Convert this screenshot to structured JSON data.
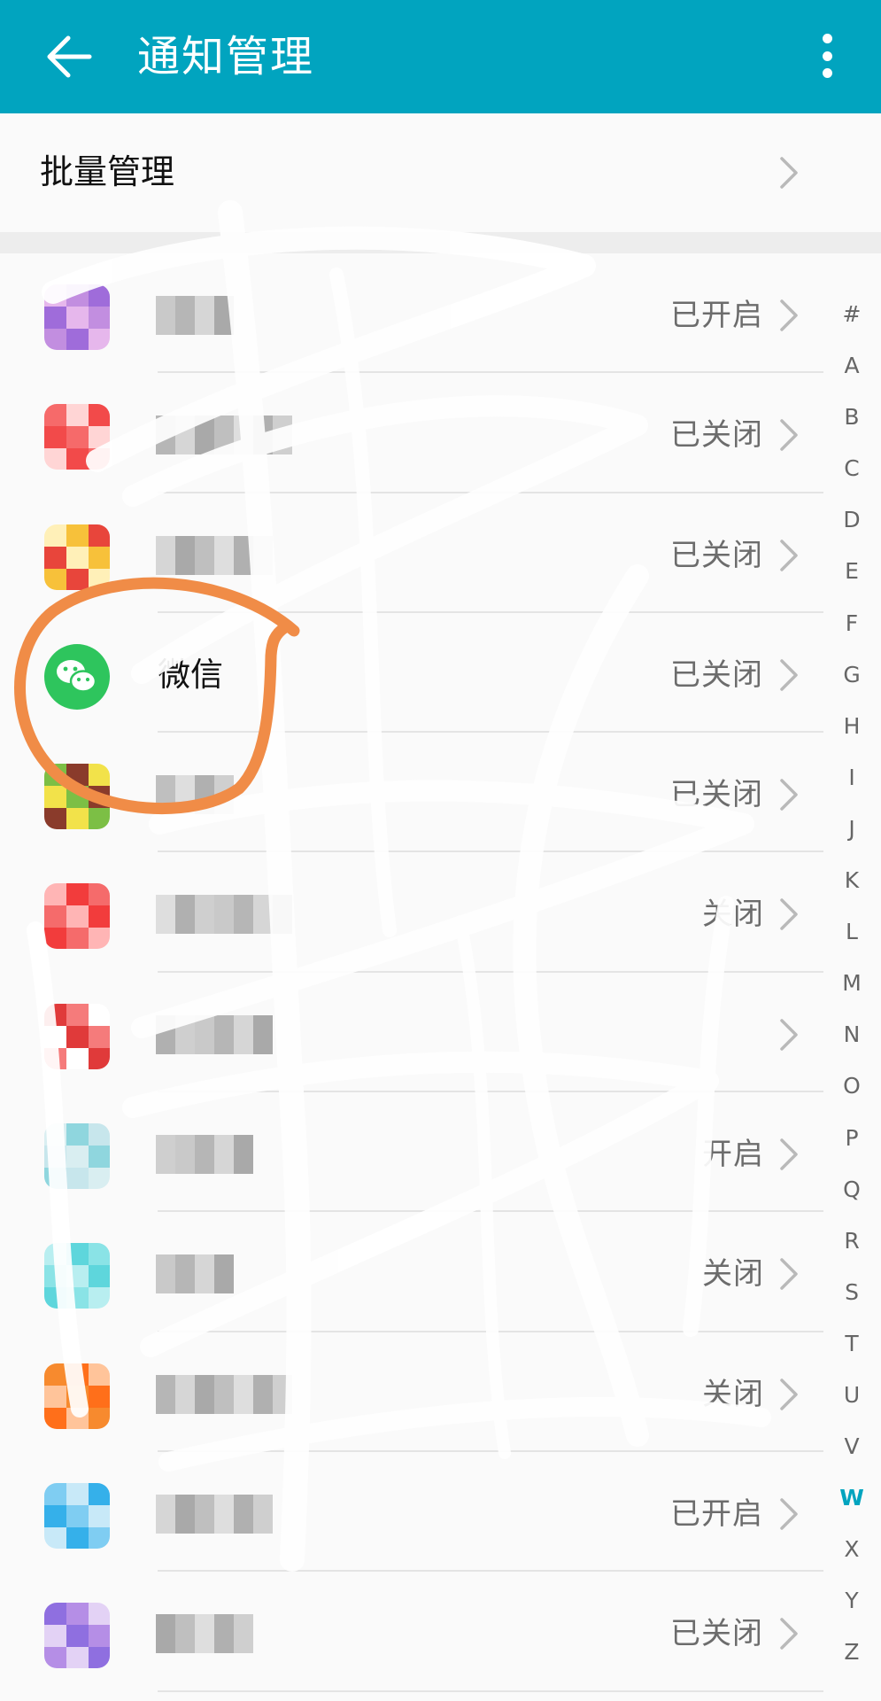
{
  "header": {
    "title": "通知管理",
    "back_icon": "arrow-left-icon",
    "more_icon": "more-vertical-icon",
    "bar_color": "#01a4bf"
  },
  "batch": {
    "label": "批量管理"
  },
  "apps": [
    {
      "name": "",
      "status": "已开启",
      "icon_colors": [
        "#e6b7ec",
        "#c28ee0",
        "#9f6cda"
      ]
    },
    {
      "name": "",
      "status": "已关闭",
      "icon_colors": [
        "#f24a4a",
        "#f66a6a",
        "#ffd5d5"
      ]
    },
    {
      "name": "",
      "status": "已关闭",
      "icon_colors": [
        "#f7c13a",
        "#e8453b",
        "#fff0b8"
      ]
    },
    {
      "name": "微信",
      "status": "已关闭",
      "icon_colors": [
        "#2ec55d",
        "#ffffff",
        "#2ec55d"
      ]
    },
    {
      "name": "",
      "status": "已关闭",
      "icon_colors": [
        "#f2e24a",
        "#7cbf45",
        "#8a3b2b"
      ]
    },
    {
      "name": "",
      "status": "关闭",
      "icon_colors": [
        "#f23c3c",
        "#f56b6b",
        "#ffb5b5"
      ]
    },
    {
      "name": "",
      "status": "",
      "icon_colors": [
        "#e03a3a",
        "#f57b7b",
        "#ffffff"
      ]
    },
    {
      "name": "",
      "status": "开启",
      "icon_colors": [
        "#c7e6ec",
        "#d9eef1",
        "#8fd6de"
      ]
    },
    {
      "name": "",
      "status": "关闭",
      "icon_colors": [
        "#5ed6dc",
        "#8ae3e6",
        "#b8eef0"
      ]
    },
    {
      "name": "",
      "status": "关闭",
      "icon_colors": [
        "#f78a2e",
        "#ff6f1a",
        "#ffc49a"
      ]
    },
    {
      "name": "",
      "status": "已开启",
      "icon_colors": [
        "#35b0ea",
        "#7fcdf2",
        "#c8e9f8"
      ]
    },
    {
      "name": "",
      "status": "已关闭",
      "icon_colors": [
        "#b58ee6",
        "#e3d2f5",
        "#8f6fe0"
      ]
    }
  ],
  "index": {
    "letters": [
      "#",
      "A",
      "B",
      "C",
      "D",
      "E",
      "F",
      "G",
      "H",
      "I",
      "J",
      "K",
      "L",
      "M",
      "N",
      "O",
      "P",
      "Q",
      "R",
      "S",
      "T",
      "U",
      "V",
      "W",
      "X",
      "Y",
      "Z"
    ],
    "active": "W",
    "active_color": "#01a4bf"
  },
  "annotation": {
    "circle_color": "#f08c47",
    "circled_item": "微信"
  }
}
